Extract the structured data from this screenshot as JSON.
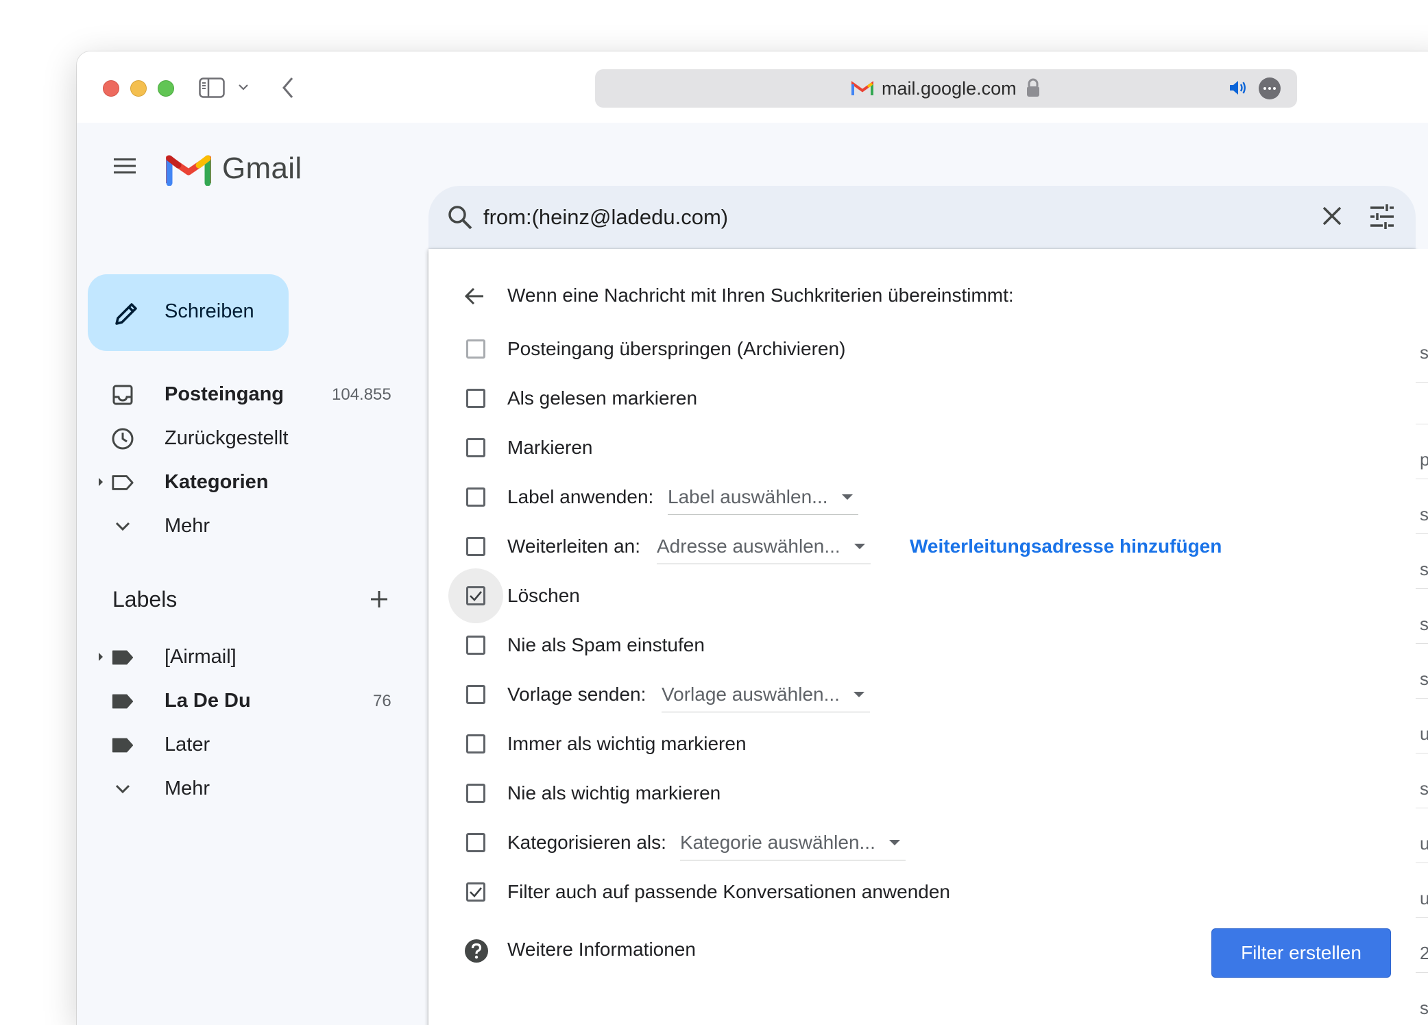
{
  "browser": {
    "url": "mail.google.com"
  },
  "app": {
    "name": "Gmail",
    "compose_label": "Schreiben"
  },
  "nav": {
    "items": [
      {
        "label": "Posteingang",
        "count": "104.855",
        "bold": true
      },
      {
        "label": "Zurückgestellt",
        "count": ""
      },
      {
        "label": "Kategorien",
        "count": "",
        "bold": true
      },
      {
        "label": "Mehr",
        "count": ""
      }
    ]
  },
  "labels": {
    "heading": "Labels",
    "items": [
      {
        "label": "[Airmail]",
        "count": ""
      },
      {
        "label": "La De Du",
        "count": "76",
        "bold": true
      },
      {
        "label": "Later",
        "count": ""
      },
      {
        "label": "Mehr",
        "count": ""
      }
    ]
  },
  "search": {
    "query": "from:(heinz@ladedu.com)"
  },
  "filter": {
    "heading": "Wenn eine Nachricht mit Ihren Suchkriterien übereinstimmt:",
    "options": [
      {
        "label": "Posteingang überspringen (Archivieren)",
        "checked": false,
        "disabled": true
      },
      {
        "label": "Als gelesen markieren",
        "checked": false
      },
      {
        "label": "Markieren",
        "checked": false
      },
      {
        "label": "Label anwenden:",
        "checked": false,
        "select": "Label auswählen..."
      },
      {
        "label": "Weiterleiten an:",
        "checked": false,
        "select": "Adresse auswählen...",
        "link": "Weiterleitungsadresse hinzufügen"
      },
      {
        "label": "Löschen",
        "checked": true,
        "focused": true
      },
      {
        "label": "Nie als Spam einstufen",
        "checked": false
      },
      {
        "label": "Vorlage senden:",
        "checked": false,
        "select": "Vorlage auswählen..."
      },
      {
        "label": "Immer als wichtig markieren",
        "checked": false
      },
      {
        "label": "Nie als wichtig markieren",
        "checked": false
      },
      {
        "label": "Kategorisieren als:",
        "checked": false,
        "select": "Kategorie auswählen..."
      },
      {
        "label": "Filter auch auf passende Konversationen anwenden",
        "checked": true
      }
    ],
    "help_label": "Weitere Informationen",
    "create_button": "Filter erstellen"
  },
  "edge_chars": [
    "s",
    "",
    "p",
    "s",
    "s",
    "s",
    "s",
    "u",
    "s",
    "u",
    "u",
    "2",
    "s"
  ],
  "colors": {
    "compose_bg": "#c2e7ff",
    "primary_button": "#3b78e7",
    "link": "#1a73e8",
    "search_bg": "#e9eef6"
  }
}
